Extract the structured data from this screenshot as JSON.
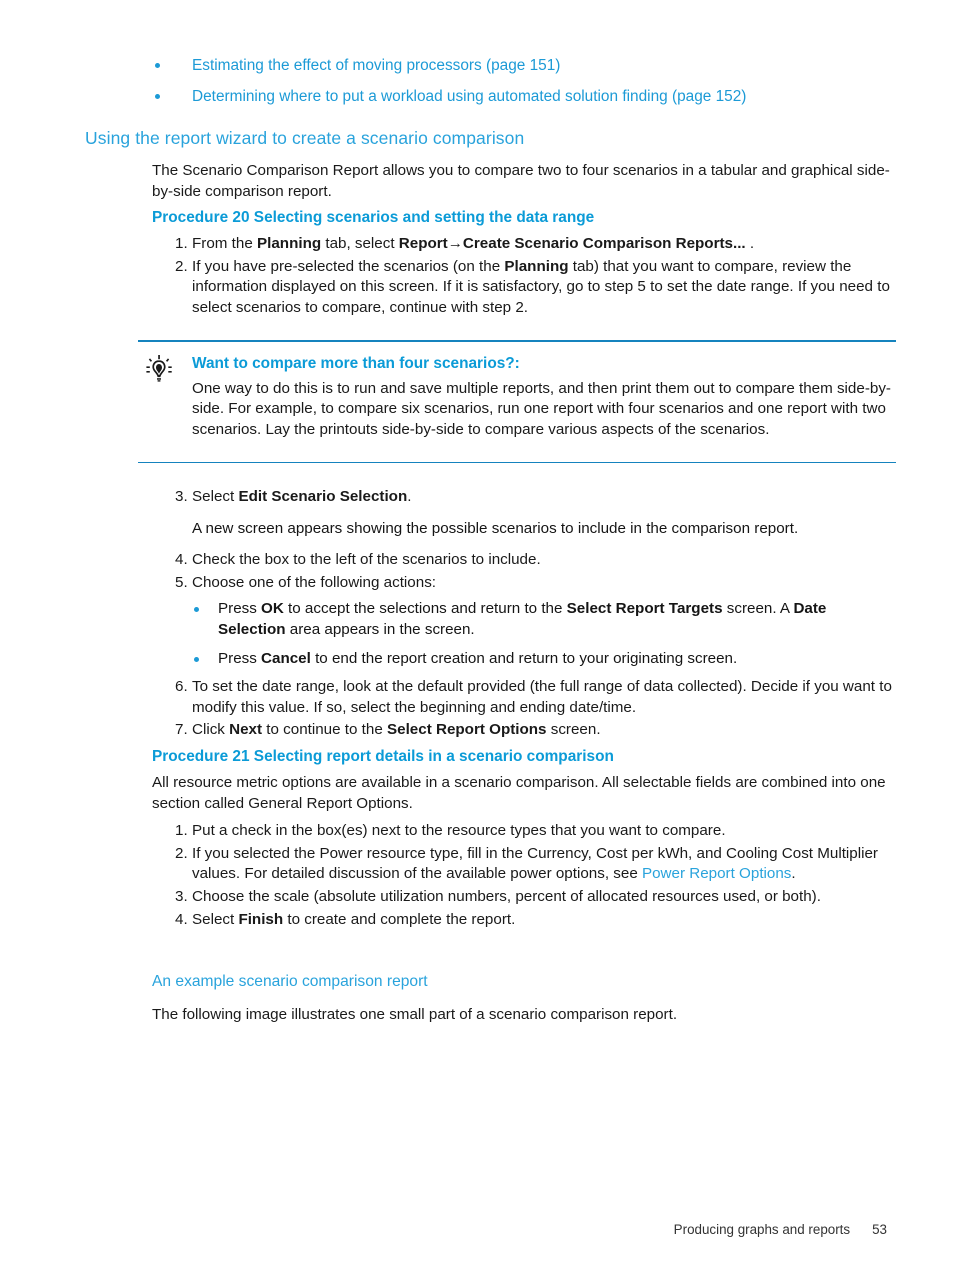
{
  "toc_links": [
    "Estimating the effect of moving processors (page 151)",
    "Determining where to put a workload using automated solution finding (page 152)"
  ],
  "section": {
    "heading": "Using the report wizard to create a scenario comparison",
    "intro": "The Scenario Comparison Report allows you to compare two to four scenarios in a tabular and graphical side-by-side comparison report."
  },
  "procedure20": {
    "heading": "Procedure 20 Selecting scenarios and setting the data range",
    "steps": [
      {
        "num": "1.",
        "parts": [
          {
            "t": "From the ",
            "b": false
          },
          {
            "t": "Planning",
            "b": true
          },
          {
            "t": " tab, select ",
            "b": false
          },
          {
            "t": "Report→Create Scenario Comparison Reports...",
            "b": true
          },
          {
            "t": " .",
            "b": false
          }
        ]
      },
      {
        "num": "2.",
        "parts": [
          {
            "t": "If you have pre-selected the scenarios (on the ",
            "b": false
          },
          {
            "t": "Planning",
            "b": true
          },
          {
            "t": " tab) that you want to compare, review the information displayed on this screen. If it is satisfactory, go to step 5 to set the date range. If you need to select scenarios to compare, continue with step 2.",
            "b": false
          }
        ]
      }
    ],
    "steps_after_tip": [
      {
        "num": "3.",
        "parts": [
          {
            "t": "Select ",
            "b": false
          },
          {
            "t": "Edit Scenario Selection",
            "b": true
          },
          {
            "t": ".",
            "b": false
          }
        ]
      }
    ],
    "step3_note": "A new screen appears showing the possible scenarios to include in the comparison report.",
    "steps_tail": [
      {
        "num": "4.",
        "parts": [
          {
            "t": "Check the box to the left of the scenarios to include.",
            "b": false
          }
        ]
      },
      {
        "num": "5.",
        "parts": [
          {
            "t": "Choose one of the following actions:",
            "b": false
          }
        ]
      }
    ],
    "step5_bullets": [
      [
        {
          "t": "Press ",
          "b": false
        },
        {
          "t": "OK",
          "b": true
        },
        {
          "t": " to accept the selections and return to the ",
          "b": false
        },
        {
          "t": "Select Report Targets",
          "b": true
        },
        {
          "t": " screen. A ",
          "b": false
        },
        {
          "t": "Date Selection",
          "b": true
        },
        {
          "t": " area appears in the screen.",
          "b": false
        }
      ],
      [
        {
          "t": "Press ",
          "b": false
        },
        {
          "t": "Cancel",
          "b": true
        },
        {
          "t": " to end the report creation and return to your originating screen.",
          "b": false
        }
      ]
    ],
    "steps_end": [
      {
        "num": "6.",
        "parts": [
          {
            "t": "To set the date range, look at the default provided (the full range of data collected). Decide if you want to modify this value. If so, select the beginning and ending date/time.",
            "b": false
          }
        ]
      },
      {
        "num": "7.",
        "parts": [
          {
            "t": "Click ",
            "b": false
          },
          {
            "t": "Next",
            "b": true
          },
          {
            "t": " to continue to the ",
            "b": false
          },
          {
            "t": "Select Report Options",
            "b": true
          },
          {
            "t": " screen.",
            "b": false
          }
        ]
      }
    ]
  },
  "tip": {
    "icon": "lightbulb-tip-icon",
    "title": "Want to compare more than four scenarios?:",
    "body": "One way to do this is to run and save multiple reports, and then print them out to compare them side-by-side. For example, to compare six scenarios, run one report with four scenarios and one report with two scenarios. Lay the printouts side-by-side to compare various aspects of the scenarios."
  },
  "procedure21": {
    "heading": "Procedure 21 Selecting report details in a scenario comparison",
    "intro": "All resource metric options are available in a scenario comparison. All selectable fields are combined into one section called General Report Options.",
    "steps": [
      {
        "num": "1.",
        "parts": [
          {
            "t": "Put a check in the box(es) next to the resource types that you want to compare.",
            "b": false
          }
        ]
      },
      {
        "num": "2.",
        "parts": [
          {
            "t": "If you selected the Power resource type, fill in the Currency, Cost per kWh, and Cooling Cost Multiplier values. For detailed discussion of the available power options, see ",
            "b": false
          },
          {
            "t": "Power Report Options",
            "b": false,
            "link": true
          },
          {
            "t": ".",
            "b": false
          }
        ]
      },
      {
        "num": "3.",
        "parts": [
          {
            "t": "Choose the scale (absolute utilization numbers, percent of allocated resources used, or both).",
            "b": false
          }
        ]
      },
      {
        "num": "4.",
        "parts": [
          {
            "t": "Select ",
            "b": false
          },
          {
            "t": "Finish",
            "b": true
          },
          {
            "t": "  to create and complete the report.",
            "b": false
          }
        ]
      }
    ]
  },
  "example_section": {
    "heading": "An example scenario comparison report",
    "body": "The following image illustrates one small part of a scenario comparison report."
  },
  "footer": {
    "chapter": "Producing graphs and reports",
    "page_number": "53"
  },
  "colors": {
    "heading_blue": "#29A3DC",
    "procedure_blue": "#0B9BD7",
    "link_blue": "#29A3DC",
    "rule_blue": "#1583BE",
    "bullet_blue": "#1C9AD6",
    "text_black": "#1a1a1a"
  }
}
